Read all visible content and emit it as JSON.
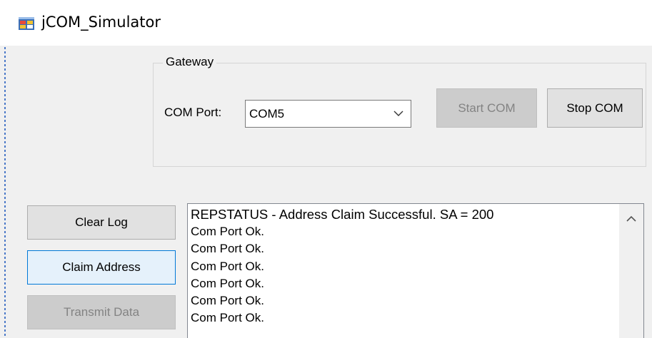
{
  "window": {
    "title": "jCOM_Simulator",
    "icon": "app-window-icon"
  },
  "gateway": {
    "legend": "Gateway",
    "com_port_label": "COM Port:",
    "com_port_value": "COM5",
    "start_label": "Start COM",
    "stop_label": "Stop COM"
  },
  "actions": {
    "clear_log": "Clear Log",
    "claim_address": "Claim Address",
    "transmit_data": "Transmit Data"
  },
  "log": {
    "lines": [
      "REPSTATUS - Address Claim Successful. SA = 200",
      "Com Port Ok.",
      "Com Port Ok.",
      "Com Port Ok.",
      "Com Port Ok.",
      "Com Port Ok.",
      "Com Port Ok."
    ]
  },
  "colors": {
    "focus_border": "#0078d7",
    "button_face": "#e1e1e1",
    "disabled_text": "#838383"
  }
}
